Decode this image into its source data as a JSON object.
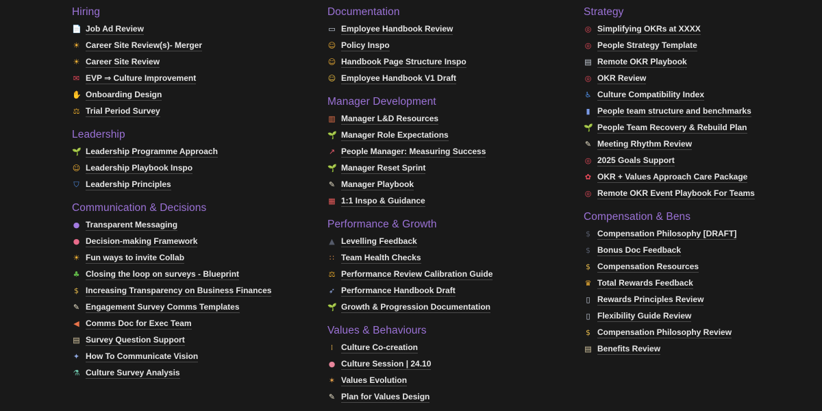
{
  "columns": [
    {
      "sections": [
        {
          "title": "Hiring",
          "items": [
            {
              "icon": "document-icon",
              "glyph": "📄",
              "color": "#cfd8e6",
              "label": "Job Ad Review"
            },
            {
              "icon": "sun-icon",
              "glyph": "☀",
              "color": "#f5b335",
              "label": "Career Site Review(s)- Merger"
            },
            {
              "icon": "sun-icon",
              "glyph": "☀",
              "color": "#f5b335",
              "label": "Career Site Review"
            },
            {
              "icon": "love-letter-icon",
              "glyph": "✉",
              "color": "#e8485a",
              "label": "EVP ⇒ Culture Improvement"
            },
            {
              "icon": "clapping-hands-icon",
              "glyph": "✋",
              "color": "#f2c84b",
              "label": "Onboarding Design"
            },
            {
              "icon": "balance-scale-icon",
              "glyph": "⚖",
              "color": "#e6a92b",
              "label": "Trial Period Survey"
            }
          ]
        },
        {
          "title": "Leadership",
          "items": [
            {
              "icon": "seedling-icon",
              "glyph": "🌱",
              "color": "#6cc24a",
              "label": "Leadership Programme Approach"
            },
            {
              "icon": "star-struck-icon",
              "glyph": "☺",
              "color": "#f5b335",
              "label": "Leadership Playbook Inspo"
            },
            {
              "icon": "shield-icon",
              "glyph": "⛉",
              "color": "#4f8fe8",
              "label": "Leadership Principles"
            }
          ]
        },
        {
          "title": "Communication & Decisions",
          "items": [
            {
              "icon": "crystal-ball-icon",
              "glyph": "●",
              "color": "#a37be0",
              "label": "Transparent Messaging"
            },
            {
              "icon": "brain-icon",
              "glyph": "●",
              "color": "#e86b8a",
              "label": "Decision-making Framework"
            },
            {
              "icon": "sun-cloud-icon",
              "glyph": "☀",
              "color": "#f5b335",
              "label": "Fun ways to invite Collab"
            },
            {
              "icon": "potted-plant-icon",
              "glyph": "♣",
              "color": "#5fb548",
              "label": "Closing the loop on surveys - Blueprint"
            },
            {
              "icon": "money-bag-icon",
              "glyph": "$",
              "color": "#e0b54a",
              "label": "Increasing Transparency on Business Finances"
            },
            {
              "icon": "memo-icon",
              "glyph": "✎",
              "color": "#e9e1c8",
              "label": "Engagement Survey Comms Templates"
            },
            {
              "icon": "megaphone-icon",
              "glyph": "◀",
              "color": "#e8734a",
              "label": "Comms Doc for Exec Team"
            },
            {
              "icon": "clipboard-icon",
              "glyph": "▤",
              "color": "#d9c9a3",
              "label": "Survey Question Support"
            },
            {
              "icon": "night-scene-icon",
              "glyph": "✦",
              "color": "#8fa7e0",
              "label": "How To Communicate Vision"
            },
            {
              "icon": "test-tube-icon",
              "glyph": "⚗",
              "color": "#6cc2a8",
              "label": "Culture Survey Analysis"
            }
          ]
        }
      ]
    },
    {
      "sections": [
        {
          "title": "Documentation",
          "items": [
            {
              "icon": "open-book-icon",
              "glyph": "▭",
              "color": "#cfd8e6",
              "label": "Employee Handbook Review"
            },
            {
              "icon": "star-struck-icon",
              "glyph": "☺",
              "color": "#f5b335",
              "label": "Policy Inspo"
            },
            {
              "icon": "star-struck-icon",
              "glyph": "☺",
              "color": "#f5b335",
              "label": "Handbook Page Structure Inspo"
            },
            {
              "icon": "smiley-icon",
              "glyph": "☺",
              "color": "#f5c542",
              "label": "Employee Handbook V1 Draft"
            }
          ]
        },
        {
          "title": "Manager Development",
          "items": [
            {
              "icon": "books-icon",
              "glyph": "▥",
              "color": "#e8734a",
              "label": "Manager L&D Resources"
            },
            {
              "icon": "seedling-icon",
              "glyph": "🌱",
              "color": "#6cc24a",
              "label": "Manager Role Expectations"
            },
            {
              "icon": "chart-increasing-icon",
              "glyph": "↗",
              "color": "#e85a6b",
              "label": "People Manager: Measuring Success"
            },
            {
              "icon": "seedling-icon",
              "glyph": "🌱",
              "color": "#6cc24a",
              "label": "Manager Reset Sprint"
            },
            {
              "icon": "memo-icon",
              "glyph": "✎",
              "color": "#e9e1c8",
              "label": "Manager Playbook"
            },
            {
              "icon": "calendar-icon",
              "glyph": "▦",
              "color": "#e85a5a",
              "label": "1:1 Inspo & Guidance"
            }
          ]
        },
        {
          "title": "Performance & Growth",
          "items": [
            {
              "icon": "graduation-cap-icon",
              "glyph": "▲",
              "color": "#555b6a",
              "label": "Levelling Feedback"
            },
            {
              "icon": "abacus-icon",
              "glyph": "∷",
              "color": "#d98c4a",
              "label": "Team Health Checks"
            },
            {
              "icon": "balance-scale-icon",
              "glyph": "⚖",
              "color": "#e6a92b",
              "label": "Performance Review Calibration Guide"
            },
            {
              "icon": "rocket-icon",
              "glyph": "➶",
              "color": "#8fa7e0",
              "label": "Performance Handbook Draft"
            },
            {
              "icon": "seedling-icon",
              "glyph": "🌱",
              "color": "#6cc24a",
              "label": "Growth & Progression Documentation"
            }
          ]
        },
        {
          "title": "Values & Behaviours",
          "items": [
            {
              "icon": "traffic-light-icon",
              "glyph": "⁞",
              "color": "#e8b34a",
              "label": "Culture Co-creation"
            },
            {
              "icon": "brain-icon",
              "glyph": "●",
              "color": "#e8869b",
              "label": "Culture Session | 24.10"
            },
            {
              "icon": "party-popper-icon",
              "glyph": "✶",
              "color": "#e8a24a",
              "label": "Values Evolution"
            },
            {
              "icon": "memo-icon",
              "glyph": "✎",
              "color": "#e9e1c8",
              "label": "Plan for Values Design"
            }
          ]
        }
      ]
    },
    {
      "sections": [
        {
          "title": "Strategy",
          "items": [
            {
              "icon": "target-icon",
              "glyph": "◎",
              "color": "#e84a5a",
              "label": "Simplifying OKRs at XXXX"
            },
            {
              "icon": "target-icon",
              "glyph": "◎",
              "color": "#e84a5a",
              "label": "People Strategy Template"
            },
            {
              "icon": "notepad-icon",
              "glyph": "▤",
              "color": "#c9d1dc",
              "label": "Remote OKR Playbook"
            },
            {
              "icon": "target-icon",
              "glyph": "◎",
              "color": "#e84a5a",
              "label": "OKR Review"
            },
            {
              "icon": "wheelchair-icon",
              "glyph": "♿",
              "color": "#4f8fe8",
              "label": "Culture Compatibility Index"
            },
            {
              "icon": "bar-chart-icon",
              "glyph": "▮",
              "color": "#7b9be8",
              "label": "People team structure and benchmarks"
            },
            {
              "icon": "seedling-icon",
              "glyph": "🌱",
              "color": "#6cc24a",
              "label": "People Team Recovery & Rebuild Plan"
            },
            {
              "icon": "memo-icon",
              "glyph": "✎",
              "color": "#e9e1c8",
              "label": "Meeting Rhythm Review"
            },
            {
              "icon": "target-icon",
              "glyph": "◎",
              "color": "#e84a5a",
              "label": "2025 Goals Support"
            },
            {
              "icon": "rose-icon",
              "glyph": "✿",
              "color": "#e84a5a",
              "label": "OKR + Values Approach Care Package"
            },
            {
              "icon": "target-icon",
              "glyph": "◎",
              "color": "#e84a5a",
              "label": "Remote OKR Event Playbook For Teams"
            }
          ]
        },
        {
          "title": "Compensation & Bens",
          "items": [
            {
              "icon": "dollar-sign-icon",
              "glyph": "$",
              "color": "#555b6a",
              "label": "Compensation Philosophy [DRAFT]"
            },
            {
              "icon": "dollar-sign-icon",
              "glyph": "$",
              "color": "#555b6a",
              "label": "Bonus Doc Feedback"
            },
            {
              "icon": "money-bag-icon",
              "glyph": "$",
              "color": "#e0b54a",
              "label": "Compensation Resources"
            },
            {
              "icon": "trophy-icon",
              "glyph": "♛",
              "color": "#f5b335",
              "label": "Total Rewards Feedback"
            },
            {
              "icon": "document-icon",
              "glyph": "▯",
              "color": "#cfd8e6",
              "label": "Rewards Principles Review"
            },
            {
              "icon": "document-icon",
              "glyph": "▯",
              "color": "#cfd8e6",
              "label": "Flexibility Guide Review"
            },
            {
              "icon": "money-bag-icon",
              "glyph": "$",
              "color": "#e0b54a",
              "label": "Compensation Philosophy Review"
            },
            {
              "icon": "clipboard-icon",
              "glyph": "▤",
              "color": "#d9c9a3",
              "label": "Benefits Review"
            }
          ]
        }
      ]
    }
  ],
  "colors": {
    "background": "#191919",
    "section_title": "#9b72d6",
    "link_text": "#e6e6e6",
    "link_underline": "#4a4a4a"
  }
}
